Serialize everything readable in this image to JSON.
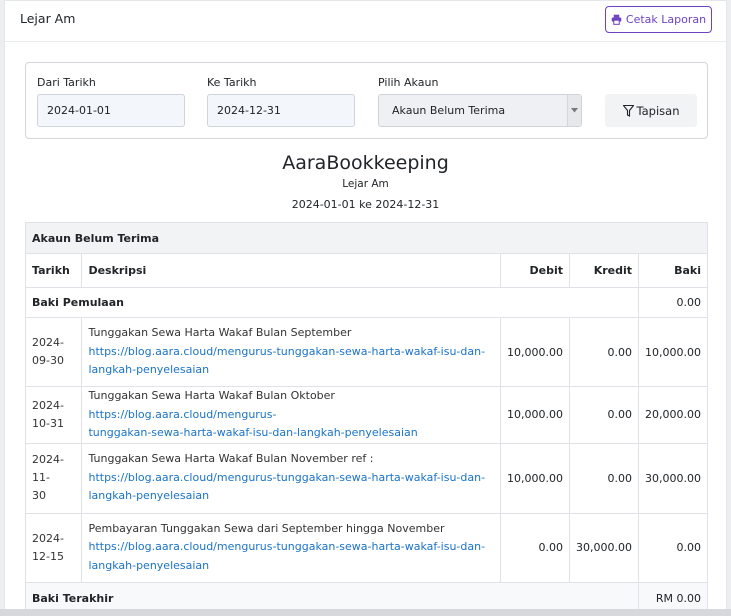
{
  "header": {
    "title": "Lejar Am",
    "print_label": "Cetak Laporan",
    "print_icon": "printer-icon"
  },
  "filters": {
    "from_label": "Dari Tarikh",
    "from_value": "2024-01-01",
    "to_label": "Ke Tarikh",
    "to_value": "2024-12-31",
    "account_label": "Pilih Akaun",
    "account_value": "Akaun Belum Terima",
    "filter_label": "Tapisan",
    "filter_icon": "filter-icon"
  },
  "report": {
    "company": "AaraBookkeeping",
    "subtitle": "Lejar Am",
    "range": "2024-01-01 ke 2024-12-31"
  },
  "table": {
    "account_name": "Akaun Belum Terima",
    "columns": {
      "date": "Tarikh",
      "desc": "Deskripsi",
      "debit": "Debit",
      "credit": "Kredit",
      "balance": "Baki"
    },
    "opening": {
      "label": "Baki Pemulaan",
      "balance": "0.00"
    },
    "rows": [
      {
        "date_a": "2024-",
        "date_b": "09-30",
        "text": "Tunggakan Sewa Harta Wakaf Bulan September",
        "link": "https://blog.aara.cloud/mengurus-tunggakan-sewa-harta-wakaf-isu-dan-langkah-penyelesaian",
        "debit": "10,000.00",
        "credit": "0.00",
        "balance": "10,000.00"
      },
      {
        "date_a": "2024-",
        "date_b": "10-31",
        "text": "Tunggakan Sewa Harta Wakaf Bulan Oktober",
        "link": "https://blog.aara.cloud/mengurus-tunggakan-sewa-harta-wakaf-isu-dan-langkah-penyelesaian",
        "debit": "10,000.00",
        "credit": "0.00",
        "balance": "20,000.00"
      },
      {
        "date_a": "2024-11-",
        "date_b": "30",
        "text": "Tunggakan Sewa Harta Wakaf Bulan November ref :",
        "link": "https://blog.aara.cloud/mengurus-tunggakan-sewa-harta-wakaf-isu-dan-langkah-penyelesaian",
        "debit": "10,000.00",
        "credit": "0.00",
        "balance": "30,000.00"
      },
      {
        "date_a": "2024-",
        "date_b": "12-15",
        "text": "Pembayaran Tunggakan Sewa dari September hingga November",
        "link": "https://blog.aara.cloud/mengurus-tunggakan-sewa-harta-wakaf-isu-dan-langkah-penyelesaian",
        "debit": "0.00",
        "credit": "30,000.00",
        "balance": "0.00"
      }
    ],
    "closing": {
      "label": "Baki Terakhir",
      "balance": "RM 0.00"
    }
  }
}
